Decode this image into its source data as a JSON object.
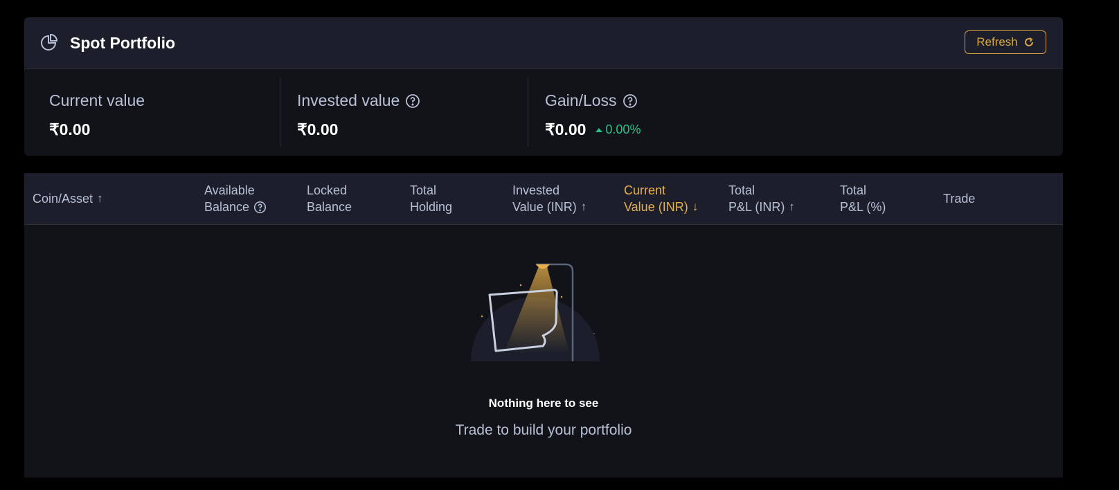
{
  "header": {
    "title": "Spot Portfolio",
    "refresh_label": "Refresh",
    "icon": "pie-chart-icon"
  },
  "stats": [
    {
      "label": "Current value",
      "value": "₹0.00",
      "help": false
    },
    {
      "label": "Invested value",
      "value": "₹0.00",
      "help": true
    },
    {
      "label": "Gain/Loss",
      "value": "₹0.00",
      "help": true,
      "change": "0.00%",
      "change_direction": "up"
    }
  ],
  "table": {
    "columns": [
      {
        "line1": "Coin/Asset",
        "line2": "",
        "sort": "↑"
      },
      {
        "line1": "Available",
        "line2": "Balance",
        "help": true
      },
      {
        "line1": "Locked",
        "line2": "Balance"
      },
      {
        "line1": "Total",
        "line2": "Holding"
      },
      {
        "line1": "Invested",
        "line2": "Value (INR)",
        "sort": "↑"
      },
      {
        "line1": "Current",
        "line2": "Value (INR)",
        "sort": "↓",
        "active": true
      },
      {
        "line1": "Total",
        "line2": "P&L (INR)",
        "sort": "↑"
      },
      {
        "line1": "Total",
        "line2": "P&L (%)"
      },
      {
        "line1": "Trade",
        "line2": ""
      }
    ]
  },
  "empty_state": {
    "title": "Nothing here to see",
    "subtitle": "Trade to build your portfolio"
  },
  "colors": {
    "background": "#000000",
    "panel": "#121318",
    "header": "#1c1f2b",
    "accent": "#d4a546",
    "positive": "#27c286",
    "muted_text": "#b8c0d6"
  }
}
